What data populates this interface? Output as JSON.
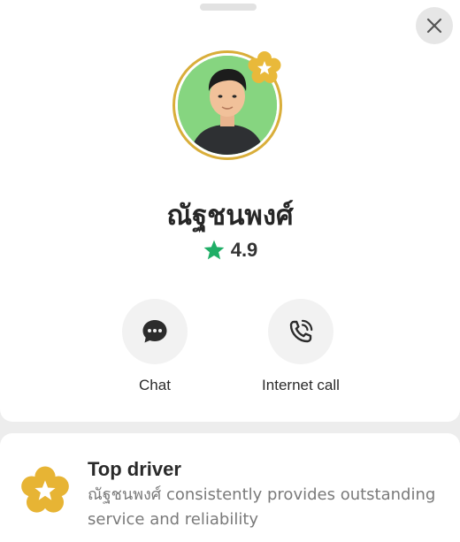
{
  "header": {
    "close_icon": "close-icon"
  },
  "profile": {
    "name": "ณัฐชนพงศ์",
    "rating": "4.9",
    "rating_icon": "star-icon",
    "badge_icon": "top-driver-star-badge-icon",
    "accent_color": "#d9ae3a",
    "star_color": "#1fae66"
  },
  "actions": [
    {
      "label": "Chat",
      "icon": "chat-bubble-icon"
    },
    {
      "label": "Internet call",
      "icon": "phone-call-icon"
    }
  ],
  "top_driver": {
    "title": "Top driver",
    "description": "ณัฐชนพงศ์ consistently provides outstanding service and reliability",
    "icon": "top-driver-star-badge-icon"
  }
}
